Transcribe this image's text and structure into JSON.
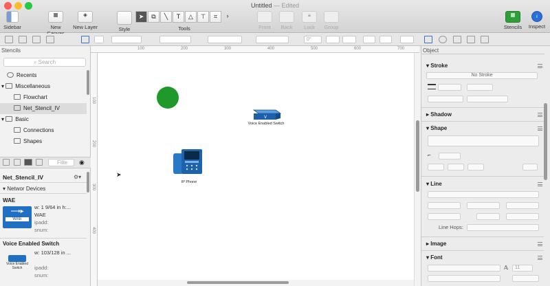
{
  "window": {
    "title": "Untitled",
    "edited": "— Edited"
  },
  "toolbar": {
    "sidebar": "Sidebar",
    "new_canvas": "New Canvas",
    "new_layer": "New Layer",
    "style": "Style",
    "tools": "Tools",
    "front": "Front",
    "back": "Back",
    "lock": "Lock",
    "group": "Group",
    "stencils": "Stencils",
    "inspect": "Inspect"
  },
  "subbar": {
    "rotation": "0°"
  },
  "sidebar": {
    "header": "Stencils",
    "search_placeholder": "Search",
    "tree": [
      {
        "label": "Recents",
        "level": 0,
        "icon": "clock-icon"
      },
      {
        "label": "Miscellaneous",
        "level": 0,
        "icon": "folder-icon",
        "expanded": true
      },
      {
        "label": "Flowchart",
        "level": 1,
        "icon": "stencil-icon"
      },
      {
        "label": "Net_Stencil_IV",
        "level": 1,
        "icon": "stencil-icon",
        "selected": true
      },
      {
        "label": "Basic",
        "level": 0,
        "icon": "folder-icon",
        "expanded": true
      },
      {
        "label": "Connections",
        "level": 1,
        "icon": "stencil-icon"
      },
      {
        "label": "Shapes",
        "level": 1,
        "icon": "stencil-icon"
      }
    ],
    "filter_placeholder": "Filte",
    "stencil_name": "Net_Stencil_IV",
    "group": "Networ Devices",
    "shapes": [
      {
        "title": "WAE",
        "thumb_label": "WAE",
        "w": "w: 1 9/64 in",
        "h": "h:...",
        "name": "WAE",
        "ipadd": "ipadd:",
        "snum": "snum:"
      },
      {
        "title": "Voice Enabled Switch",
        "thumb_label": "Voice Enabled Switch",
        "w": "w: 103/128 in",
        "h": "...",
        "ipadd": "ipadd:",
        "snum": "snum:"
      }
    ]
  },
  "ruler": {
    "top_ticks": [
      "100",
      "200",
      "300",
      "400",
      "500",
      "600",
      "700"
    ],
    "left_ticks": [
      "100",
      "200",
      "300",
      "400"
    ]
  },
  "canvas": {
    "circle_color": "#1f9a2a",
    "switch_label": "Voice Enabled Switch",
    "switch_letter": "V",
    "phone_label": "IP Phone"
  },
  "inspector": {
    "header": "Object",
    "stroke": "Stroke",
    "stroke_value": "No Stroke",
    "shadow": "Shadow",
    "shape": "Shape",
    "line": "Line",
    "line_hops": "Line Hops:",
    "image": "Image",
    "font": "Font",
    "font_size": "11"
  }
}
